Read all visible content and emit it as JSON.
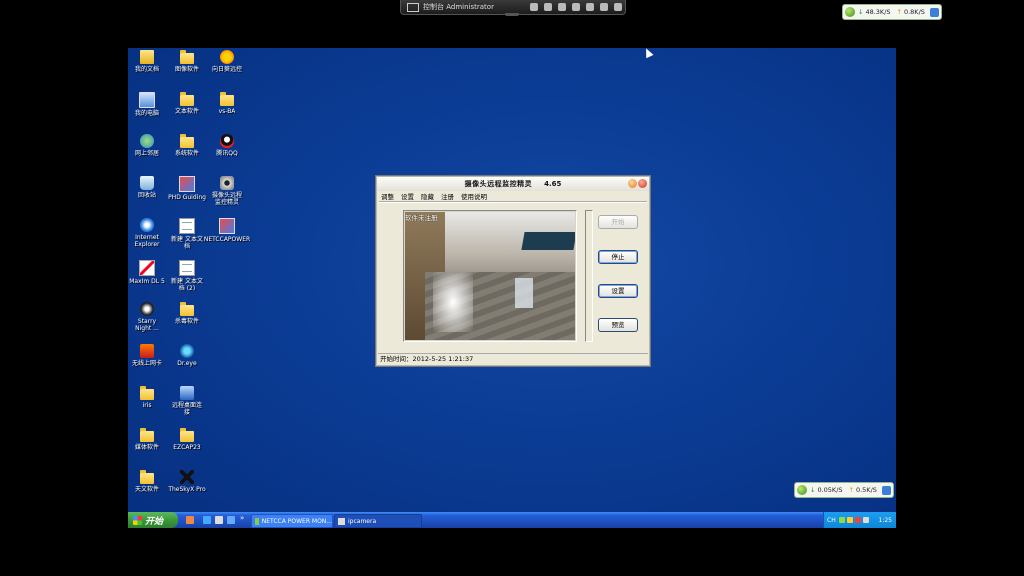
{
  "remote_bar": {
    "title": "控制台 Administrator"
  },
  "speed_top": {
    "down": "48.3K/S",
    "up": "0.8K/S"
  },
  "speed_bottom": {
    "down": "0.05K/S",
    "up": "0.5K/S"
  },
  "desktop_icons": [
    {
      "label": "我的文档",
      "icon": "my-documents-icon"
    },
    {
      "label": "图像软件",
      "icon": "folder-icon"
    },
    {
      "label": "向日葵远控",
      "icon": "sunflower-icon"
    },
    {
      "label": "我的电脑",
      "icon": "my-computer-icon"
    },
    {
      "label": "文本软件",
      "icon": "folder-icon"
    },
    {
      "label": "vs-BA",
      "icon": "folder-icon"
    },
    {
      "label": "网上邻居",
      "icon": "network-places-icon"
    },
    {
      "label": "系统软件",
      "icon": "folder-icon"
    },
    {
      "label": "腾讯QQ",
      "icon": "qq-icon"
    },
    {
      "label": "回收站",
      "icon": "recycle-bin-icon"
    },
    {
      "label": "PHD Guiding",
      "icon": "phd-guiding-icon"
    },
    {
      "label": "摄像头远程\n监控精灵",
      "icon": "camera-icon"
    },
    {
      "label": "Internet\nExplorer",
      "icon": "internet-explorer-icon"
    },
    {
      "label": "新建 文本文\n档",
      "icon": "text-document-icon"
    },
    {
      "label": "NETCCAPOWER",
      "icon": "netcca-icon"
    },
    {
      "label": "MaxIm DL 5",
      "icon": "maxim-dl-icon"
    },
    {
      "label": "新建 文本文\n档 (2)",
      "icon": "text-document-icon"
    },
    {
      "label": "Starry\nNight ...",
      "icon": "starry-night-icon"
    },
    {
      "label": "杀毒软件",
      "icon": "folder-icon"
    },
    {
      "label": "无线上网卡",
      "icon": "wireless-card-icon"
    },
    {
      "label": "Dr.eye",
      "icon": "dr-eye-icon"
    },
    {
      "label": "iris",
      "icon": "iris-icon"
    },
    {
      "label": "远程桌面连\n接",
      "icon": "remote-desktop-icon"
    },
    {
      "label": "媒体软件",
      "icon": "folder-icon"
    },
    {
      "label": "EZCAP23",
      "icon": "folder-icon"
    },
    {
      "label": "天文软件",
      "icon": "folder-icon"
    },
    {
      "label": "TheSkyX Pro",
      "icon": "theskyx-icon"
    }
  ],
  "app": {
    "title": "摄像头远程监控精灵",
    "version": "4.65",
    "menu": [
      "调整",
      "设置",
      "隐藏",
      "注册",
      "使用说明"
    ],
    "overlay": "软件未注册",
    "buttons": {
      "start": "开始",
      "stop": "停止",
      "settings": "设置",
      "preview": "预览"
    },
    "status": "开始时间：2012-5-25 1:21:37"
  },
  "taskbar": {
    "start_label": "开始",
    "overflow": "»",
    "tasks": [
      "NETCCA POWER MON...",
      "ipcamera"
    ],
    "lang": "CH",
    "clock": "1:25"
  }
}
